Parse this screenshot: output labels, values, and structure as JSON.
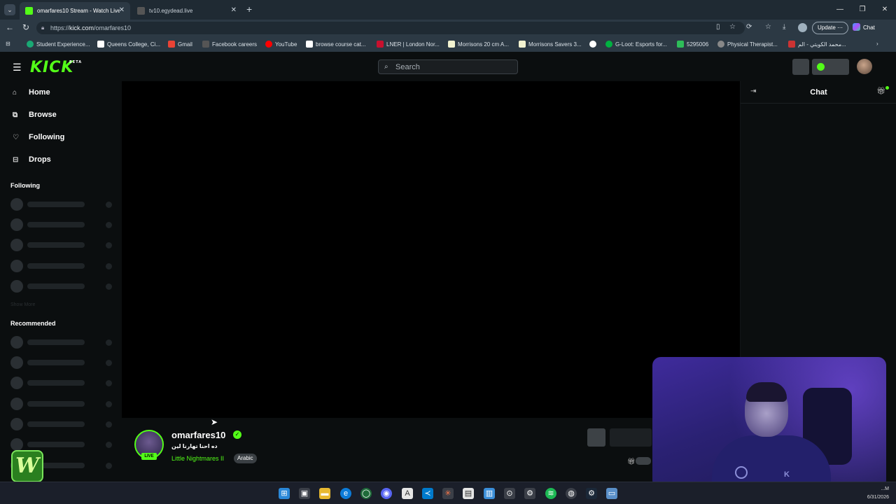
{
  "browser": {
    "tabs": [
      {
        "title": "omarfares10 Stream - Watch Live o",
        "active": true,
        "favicon_color": "#53fc18"
      },
      {
        "title": "tv10.egydead.live",
        "active": false,
        "favicon_color": "#555555"
      }
    ],
    "url_prefix": "https://",
    "url_host": "kick.com",
    "url_path": "/omarfares10",
    "update_label": "Update",
    "chat_label": "Chat",
    "bookmarks": [
      {
        "label": "Student Experience...",
        "color": "#19a974"
      },
      {
        "label": "Queens College, Ci...",
        "color": "#ffffff"
      },
      {
        "label": "Gmail",
        "color": "#ea4335"
      },
      {
        "label": "Facebook careers",
        "color": "#555555"
      },
      {
        "label": "YouTube",
        "color": "#ff0000"
      },
      {
        "label": "browse course cat...",
        "color": "#ffffff"
      },
      {
        "label": "LNER | London Nor...",
        "color": "#c8102e"
      },
      {
        "label": "Morrisons 20 cm A...",
        "color": "#f2f2d0"
      },
      {
        "label": "Morrisons Savers 3...",
        "color": "#f2f2d0"
      },
      {
        "label": "",
        "color": "#ffffff"
      },
      {
        "label": "G-Loot: Esports for...",
        "color": "#00b140"
      },
      {
        "label": "5295006",
        "color": "#2ebd59"
      },
      {
        "label": "Physical Therapist...",
        "color": "#888888"
      },
      {
        "label": "محمد الكويتي - الم...",
        "color": "#cc3333"
      }
    ]
  },
  "kick": {
    "logo": "KICK",
    "beta": "BETA",
    "search_placeholder": "Search",
    "nav": [
      {
        "label": "Home",
        "icon": "home-icon"
      },
      {
        "label": "Browse",
        "icon": "browse-icon"
      },
      {
        "label": "Following",
        "icon": "heart-icon"
      },
      {
        "label": "Drops",
        "icon": "drops-icon"
      }
    ],
    "following_heading": "Following",
    "show_more": "Show More",
    "recommended_heading": "Recommended",
    "chat_title": "Chat",
    "channel": {
      "name": "omarfares10",
      "live_badge": "LIVE",
      "stream_title": "ده احنا تهارنا لين",
      "category": "Little Nightmares II",
      "language": "Arabic"
    },
    "accent": "#53fc18"
  },
  "taskbar": {
    "time": "...M",
    "date": "6/31/2026"
  }
}
